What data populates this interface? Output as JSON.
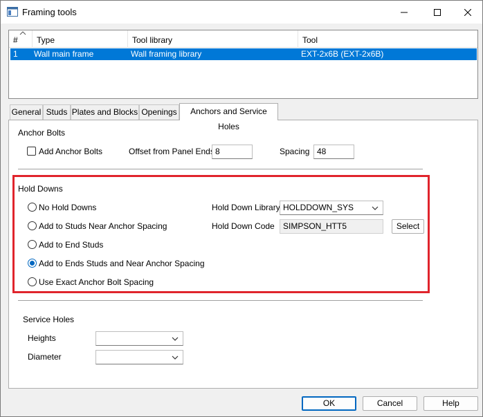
{
  "window": {
    "title": "Framing tools"
  },
  "tool_list": {
    "columns": [
      "#",
      "Type",
      "Tool library",
      "Tool"
    ],
    "rows": [
      {
        "num": "1",
        "type": "Wall main frame",
        "library": "Wall framing library",
        "tool": "EXT-2x6B (EXT-2x6B)"
      }
    ]
  },
  "tabs": [
    "General",
    "Studs",
    "Plates and Blocks",
    "Openings",
    "Anchors and Service Holes"
  ],
  "anchor_bolts": {
    "heading": "Anchor Bolts",
    "add_label": "Add Anchor Bolts",
    "add_checked": false,
    "offset_label": "Offset from Panel Ends",
    "offset_value": "8",
    "spacing_label": "Spacing",
    "spacing_value": "48"
  },
  "hold_downs": {
    "heading": "Hold Downs",
    "options": [
      "No Hold Downs",
      "Add to Studs Near Anchor Spacing",
      "Add to End Studs",
      "Add to Ends Studs and Near Anchor Spacing",
      "Use Exact Anchor Bolt Spacing"
    ],
    "selected_index": 3,
    "library_label": "Hold Down Library",
    "library_value": "HOLDDOWN_SYS",
    "code_label": "Hold Down Code",
    "code_value": "SIMPSON_HTT5",
    "select_button": "Select"
  },
  "service_holes": {
    "heading": "Service Holes",
    "heights_label": "Heights",
    "heights_value": "",
    "diameter_label": "Diameter",
    "diameter_value": ""
  },
  "buttons": {
    "ok": "OK",
    "cancel": "Cancel",
    "help": "Help"
  },
  "colors": {
    "selection": "#0078d7",
    "highlight_border": "#e0242c",
    "radio_accent": "#0067c0"
  }
}
